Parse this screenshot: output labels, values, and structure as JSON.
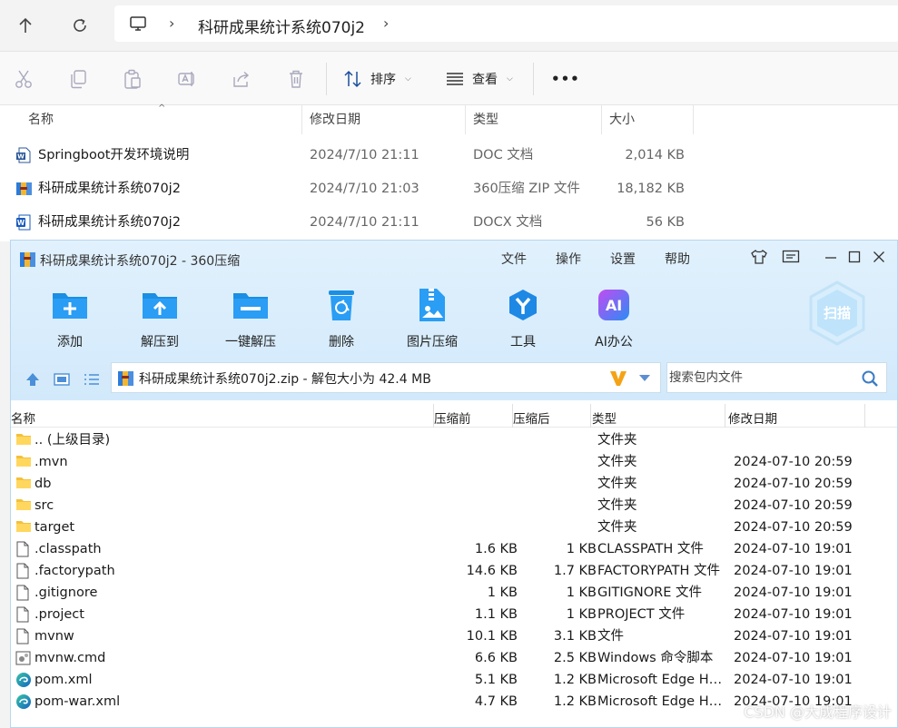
{
  "explorer": {
    "breadcrumb": {
      "current": "科研成果统计系统070j2"
    },
    "toolbar": {
      "sort_label": "排序",
      "view_label": "查看",
      "more_label": "•••"
    },
    "columns": {
      "name": "名称",
      "modified": "修改日期",
      "type": "类型",
      "size": "大小"
    },
    "files": [
      {
        "name": "Springboot开发环境说明",
        "modified": "2024/7/10 21:11",
        "type": "DOC 文档",
        "size": "2,014 KB",
        "icon": "word-doc-icon"
      },
      {
        "name": "科研成果统计系统070j2",
        "modified": "2024/7/10 21:03",
        "type": "360压缩 ZIP 文件",
        "size": "18,182 KB",
        "icon": "zip-archive-icon"
      },
      {
        "name": "科研成果统计系统070j2",
        "modified": "2024/7/10 21:11",
        "type": "DOCX 文档",
        "size": "56 KB",
        "icon": "word-docx-icon"
      }
    ]
  },
  "zip": {
    "title": "科研成果统计系统070j2 - 360压缩",
    "menu": [
      "文件",
      "操作",
      "设置",
      "帮助"
    ],
    "tools": [
      {
        "label": "添加",
        "icon": "add-folder-icon"
      },
      {
        "label": "解压到",
        "icon": "extract-to-icon"
      },
      {
        "label": "一键解压",
        "icon": "one-click-extract-icon"
      },
      {
        "label": "删除",
        "icon": "recycle-delete-icon"
      },
      {
        "label": "图片压缩",
        "icon": "image-compress-icon"
      },
      {
        "label": "工具",
        "icon": "tools-icon"
      },
      {
        "label": "AI办公",
        "icon": "ai-office-icon"
      }
    ],
    "scan_label": "扫描",
    "path": "科研成果统计系统070j2.zip - 解包大小为 42.4 MB",
    "search_placeholder": "搜索包内文件",
    "columns": {
      "name": "名称",
      "before": "压缩前",
      "after": "压缩后",
      "type": "类型",
      "modified": "修改日期"
    },
    "entries": [
      {
        "name": ".. (上级目录)",
        "before": "",
        "after": "",
        "type": "文件夹",
        "modified": "",
        "icon": "folder-icon"
      },
      {
        "name": ".mvn",
        "before": "",
        "after": "",
        "type": "文件夹",
        "modified": "2024-07-10 20:59",
        "icon": "folder-icon"
      },
      {
        "name": "db",
        "before": "",
        "after": "",
        "type": "文件夹",
        "modified": "2024-07-10 20:59",
        "icon": "folder-icon"
      },
      {
        "name": "src",
        "before": "",
        "after": "",
        "type": "文件夹",
        "modified": "2024-07-10 20:59",
        "icon": "folder-icon"
      },
      {
        "name": "target",
        "before": "",
        "after": "",
        "type": "文件夹",
        "modified": "2024-07-10 20:59",
        "icon": "folder-icon"
      },
      {
        "name": ".classpath",
        "before": "1.6 KB",
        "after": "1 KB",
        "type": "CLASSPATH 文件",
        "modified": "2024-07-10 19:01",
        "icon": "file-icon"
      },
      {
        "name": ".factorypath",
        "before": "14.6 KB",
        "after": "1.7 KB",
        "type": "FACTORYPATH 文件",
        "modified": "2024-07-10 19:01",
        "icon": "file-icon"
      },
      {
        "name": ".gitignore",
        "before": "1 KB",
        "after": "1 KB",
        "type": "GITIGNORE 文件",
        "modified": "2024-07-10 19:01",
        "icon": "file-icon"
      },
      {
        "name": ".project",
        "before": "1.1 KB",
        "after": "1 KB",
        "type": "PROJECT 文件",
        "modified": "2024-07-10 19:01",
        "icon": "file-icon"
      },
      {
        "name": "mvnw",
        "before": "10.1 KB",
        "after": "3.1 KB",
        "type": "文件",
        "modified": "2024-07-10 19:01",
        "icon": "file-icon"
      },
      {
        "name": "mvnw.cmd",
        "before": "6.6 KB",
        "after": "2.5 KB",
        "type": "Windows 命令脚本",
        "modified": "2024-07-10 19:01",
        "icon": "cmd-script-icon"
      },
      {
        "name": "pom.xml",
        "before": "5.1 KB",
        "after": "1.2 KB",
        "type": "Microsoft Edge HT...",
        "modified": "2024-07-10 19:01",
        "icon": "edge-icon"
      },
      {
        "name": "pom-war.xml",
        "before": "4.7 KB",
        "after": "1.2 KB",
        "type": "Microsoft Edge HT...",
        "modified": "2024-07-10 19:01",
        "icon": "edge-icon"
      }
    ]
  },
  "watermark": "CSDN @大成程序设计"
}
